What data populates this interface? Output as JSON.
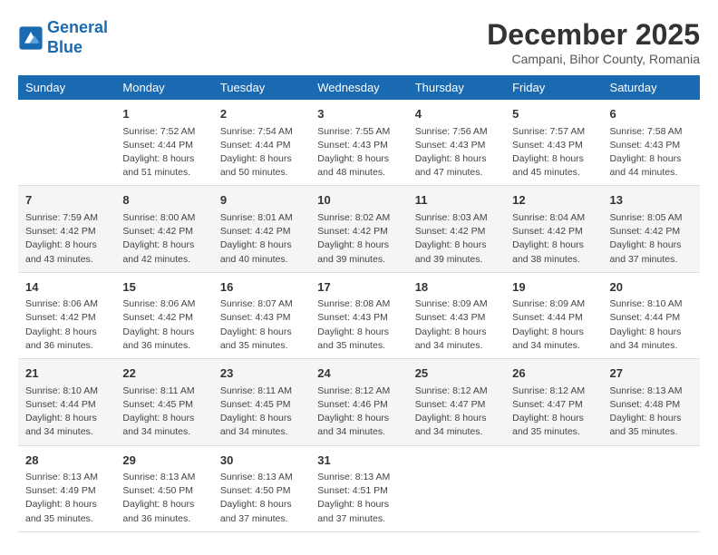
{
  "header": {
    "logo_line1": "General",
    "logo_line2": "Blue",
    "title": "December 2025",
    "subtitle": "Campani, Bihor County, Romania"
  },
  "weekdays": [
    "Sunday",
    "Monday",
    "Tuesday",
    "Wednesday",
    "Thursday",
    "Friday",
    "Saturday"
  ],
  "weeks": [
    [
      {
        "day": "",
        "info": ""
      },
      {
        "day": "1",
        "info": "Sunrise: 7:52 AM\nSunset: 4:44 PM\nDaylight: 8 hours\nand 51 minutes."
      },
      {
        "day": "2",
        "info": "Sunrise: 7:54 AM\nSunset: 4:44 PM\nDaylight: 8 hours\nand 50 minutes."
      },
      {
        "day": "3",
        "info": "Sunrise: 7:55 AM\nSunset: 4:43 PM\nDaylight: 8 hours\nand 48 minutes."
      },
      {
        "day": "4",
        "info": "Sunrise: 7:56 AM\nSunset: 4:43 PM\nDaylight: 8 hours\nand 47 minutes."
      },
      {
        "day": "5",
        "info": "Sunrise: 7:57 AM\nSunset: 4:43 PM\nDaylight: 8 hours\nand 45 minutes."
      },
      {
        "day": "6",
        "info": "Sunrise: 7:58 AM\nSunset: 4:43 PM\nDaylight: 8 hours\nand 44 minutes."
      }
    ],
    [
      {
        "day": "7",
        "info": "Sunrise: 7:59 AM\nSunset: 4:42 PM\nDaylight: 8 hours\nand 43 minutes."
      },
      {
        "day": "8",
        "info": "Sunrise: 8:00 AM\nSunset: 4:42 PM\nDaylight: 8 hours\nand 42 minutes."
      },
      {
        "day": "9",
        "info": "Sunrise: 8:01 AM\nSunset: 4:42 PM\nDaylight: 8 hours\nand 40 minutes."
      },
      {
        "day": "10",
        "info": "Sunrise: 8:02 AM\nSunset: 4:42 PM\nDaylight: 8 hours\nand 39 minutes."
      },
      {
        "day": "11",
        "info": "Sunrise: 8:03 AM\nSunset: 4:42 PM\nDaylight: 8 hours\nand 39 minutes."
      },
      {
        "day": "12",
        "info": "Sunrise: 8:04 AM\nSunset: 4:42 PM\nDaylight: 8 hours\nand 38 minutes."
      },
      {
        "day": "13",
        "info": "Sunrise: 8:05 AM\nSunset: 4:42 PM\nDaylight: 8 hours\nand 37 minutes."
      }
    ],
    [
      {
        "day": "14",
        "info": "Sunrise: 8:06 AM\nSunset: 4:42 PM\nDaylight: 8 hours\nand 36 minutes."
      },
      {
        "day": "15",
        "info": "Sunrise: 8:06 AM\nSunset: 4:42 PM\nDaylight: 8 hours\nand 36 minutes."
      },
      {
        "day": "16",
        "info": "Sunrise: 8:07 AM\nSunset: 4:43 PM\nDaylight: 8 hours\nand 35 minutes."
      },
      {
        "day": "17",
        "info": "Sunrise: 8:08 AM\nSunset: 4:43 PM\nDaylight: 8 hours\nand 35 minutes."
      },
      {
        "day": "18",
        "info": "Sunrise: 8:09 AM\nSunset: 4:43 PM\nDaylight: 8 hours\nand 34 minutes."
      },
      {
        "day": "19",
        "info": "Sunrise: 8:09 AM\nSunset: 4:44 PM\nDaylight: 8 hours\nand 34 minutes."
      },
      {
        "day": "20",
        "info": "Sunrise: 8:10 AM\nSunset: 4:44 PM\nDaylight: 8 hours\nand 34 minutes."
      }
    ],
    [
      {
        "day": "21",
        "info": "Sunrise: 8:10 AM\nSunset: 4:44 PM\nDaylight: 8 hours\nand 34 minutes."
      },
      {
        "day": "22",
        "info": "Sunrise: 8:11 AM\nSunset: 4:45 PM\nDaylight: 8 hours\nand 34 minutes."
      },
      {
        "day": "23",
        "info": "Sunrise: 8:11 AM\nSunset: 4:45 PM\nDaylight: 8 hours\nand 34 minutes."
      },
      {
        "day": "24",
        "info": "Sunrise: 8:12 AM\nSunset: 4:46 PM\nDaylight: 8 hours\nand 34 minutes."
      },
      {
        "day": "25",
        "info": "Sunrise: 8:12 AM\nSunset: 4:47 PM\nDaylight: 8 hours\nand 34 minutes."
      },
      {
        "day": "26",
        "info": "Sunrise: 8:12 AM\nSunset: 4:47 PM\nDaylight: 8 hours\nand 35 minutes."
      },
      {
        "day": "27",
        "info": "Sunrise: 8:13 AM\nSunset: 4:48 PM\nDaylight: 8 hours\nand 35 minutes."
      }
    ],
    [
      {
        "day": "28",
        "info": "Sunrise: 8:13 AM\nSunset: 4:49 PM\nDaylight: 8 hours\nand 35 minutes."
      },
      {
        "day": "29",
        "info": "Sunrise: 8:13 AM\nSunset: 4:50 PM\nDaylight: 8 hours\nand 36 minutes."
      },
      {
        "day": "30",
        "info": "Sunrise: 8:13 AM\nSunset: 4:50 PM\nDaylight: 8 hours\nand 37 minutes."
      },
      {
        "day": "31",
        "info": "Sunrise: 8:13 AM\nSunset: 4:51 PM\nDaylight: 8 hours\nand 37 minutes."
      },
      {
        "day": "",
        "info": ""
      },
      {
        "day": "",
        "info": ""
      },
      {
        "day": "",
        "info": ""
      }
    ]
  ]
}
